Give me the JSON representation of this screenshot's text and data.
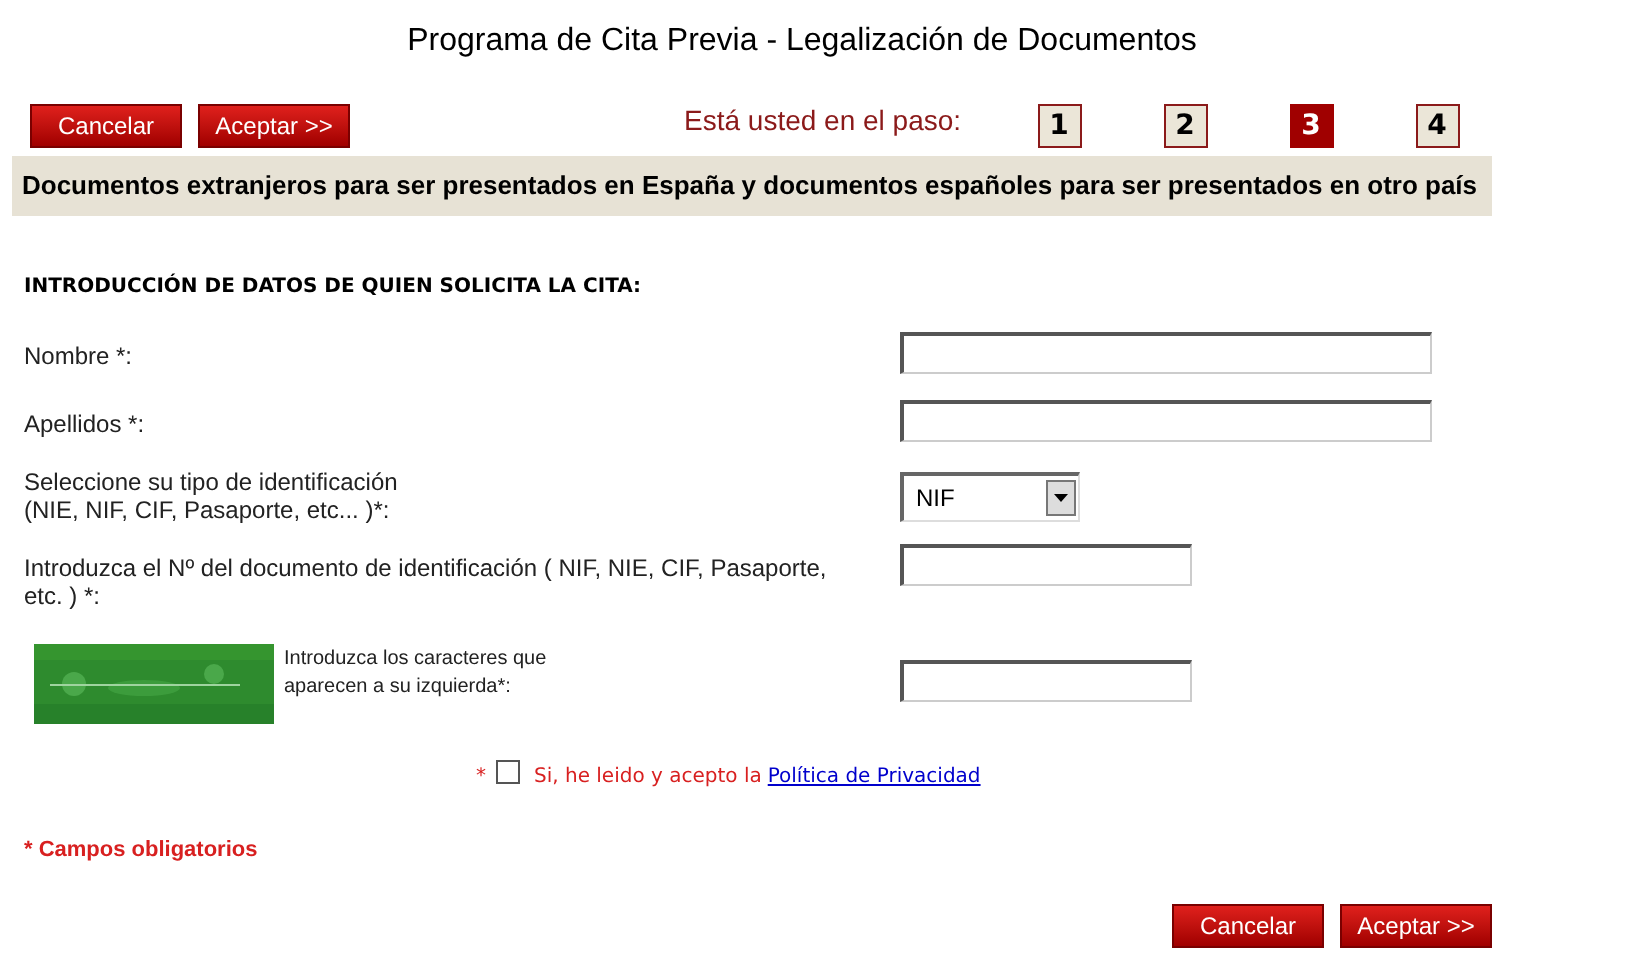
{
  "title": "Programa de Cita Previa - Legalización de Documentos",
  "top_buttons": [
    "Cancelar",
    "Aceptar >>"
  ],
  "step_label": "Está usted en el paso:",
  "steps": [
    {
      "label": "1",
      "selected": false
    },
    {
      "label": "2",
      "selected": false
    },
    {
      "label": "3",
      "selected": true
    },
    {
      "label": "4",
      "selected": false
    }
  ],
  "banner": "Documentos extranjeros para ser presentados en España y documentos españoles para ser presentados en otro país",
  "section_title": "INTRODUCCIÓN DE DATOS DE QUIEN SOLICITA LA CITA:",
  "fields": [
    {
      "kind": "wide",
      "label": "Nombre *:"
    },
    {
      "kind": "wide",
      "label": "Apellidos *:"
    },
    {
      "kind": "select",
      "label": "Seleccione su tipo de identificación\n(NIE, NIF, CIF, Pasaporte, etc... )*:",
      "value": "NIF"
    },
    {
      "kind": "narrow",
      "label": "Introduzca el Nº del documento de identificación ( NIF, NIE, CIF, Pasaporte, etc. ) *:"
    },
    {
      "kind": "captcha",
      "label": "Introduzca los caracteres que aparecen a su izquierda*:"
    }
  ],
  "consent": {
    "mark": "*",
    "checked": false,
    "text": "Si, he leido y acepto la",
    "link": "Política de Privacidad"
  },
  "required_note": "* Campos obligatorios",
  "bottom_buttons": [
    "Cancelar",
    "Aceptar >>"
  ]
}
